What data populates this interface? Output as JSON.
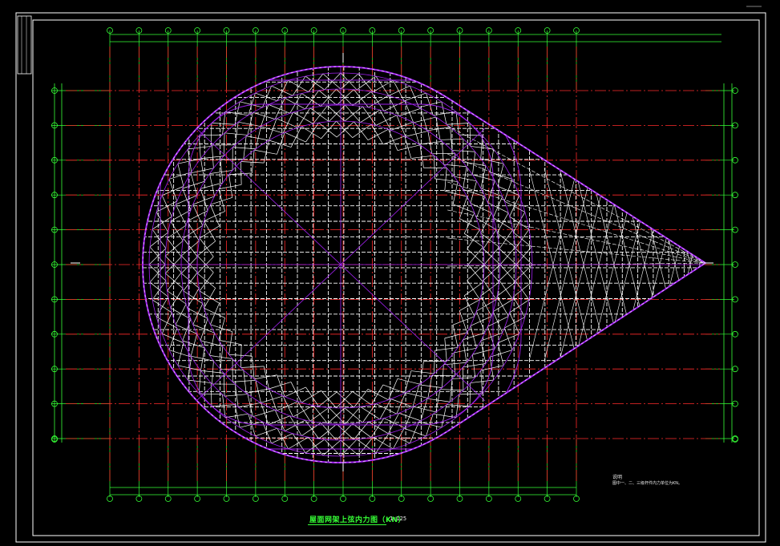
{
  "drawing": {
    "title": "屋面网架上弦内力图（KN）",
    "scale": "1:125",
    "note_heading": "说明",
    "note_body": "图中一、二、三级杆件内力单位为KN。"
  },
  "grid": {
    "column_count": 17,
    "row_count": 11
  },
  "colors": {
    "background": "#000000",
    "frame": "#ffffff",
    "axis_lines": "#ff2a2a",
    "dimension_lines": "#36ff36",
    "truss_members": "#ffffff",
    "truss_outline": "#a020f0",
    "title": "#36ff36"
  }
}
